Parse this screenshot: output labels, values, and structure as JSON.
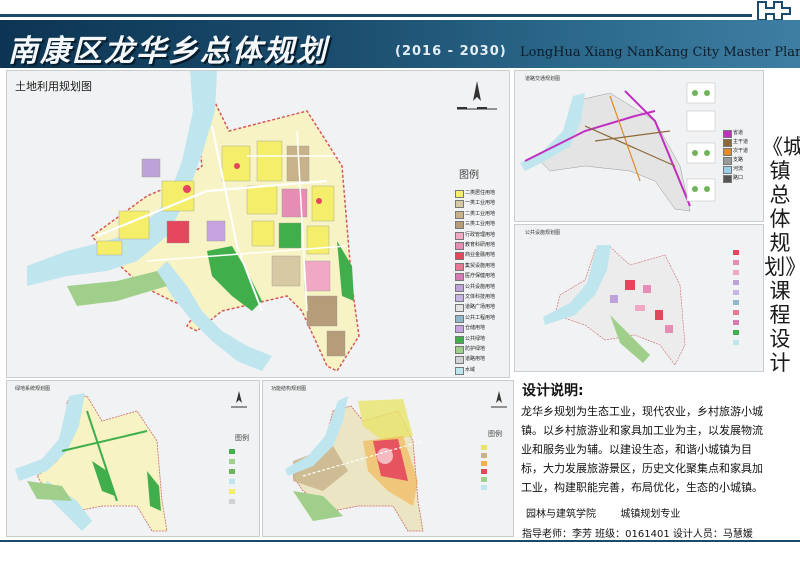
{
  "header": {
    "title_cn": "南康区龙华乡总体规划",
    "years": "(2016 - 2030)",
    "title_en": "LongHua Xiang NanKang City Master Plan"
  },
  "main_map": {
    "title": "土地利用规划图",
    "legend_title": "图例",
    "legend": [
      {
        "label": "二类居住用地",
        "color": "#f4ee6a"
      },
      {
        "label": "一类工业用地",
        "color": "#d7c9a3"
      },
      {
        "label": "二类工业用地",
        "color": "#c7b28a"
      },
      {
        "label": "三类工业用地",
        "color": "#b79c7a"
      },
      {
        "label": "行政管理用地",
        "color": "#f1a8c5"
      },
      {
        "label": "教育科研用地",
        "color": "#e58db5"
      },
      {
        "label": "商业金融用地",
        "color": "#e4475d"
      },
      {
        "label": "集贸设施用地",
        "color": "#e57a94"
      },
      {
        "label": "医疗保健用地",
        "color": "#d97ab7"
      },
      {
        "label": "公共设施用地",
        "color": "#bda2d7"
      },
      {
        "label": "文体科技用地",
        "color": "#c6b4e2"
      },
      {
        "label": "道路广场用地",
        "color": "#e3e3e3"
      },
      {
        "label": "公共工程用地",
        "color": "#8fb8c8"
      },
      {
        "label": "仓储用地",
        "color": "#c5a2e0"
      },
      {
        "label": "公共绿地",
        "color": "#3fae4b"
      },
      {
        "label": "防护绿地",
        "color": "#9fcf8a"
      },
      {
        "label": "道路用地",
        "color": "#cfd3d6"
      },
      {
        "label": "水域",
        "color": "#bfe5ee"
      }
    ]
  },
  "tr_map": {
    "title": "道路交通规划图",
    "legend": [
      {
        "label": "省道",
        "color": "#c02fc0"
      },
      {
        "label": "主干道",
        "color": "#8b6a3a"
      },
      {
        "label": "次干道",
        "color": "#e08a2a"
      },
      {
        "label": "支路",
        "color": "#9a9a9a"
      },
      {
        "label": "河流",
        "color": "#9ad0e8"
      },
      {
        "label": "路口",
        "color": "#555555"
      }
    ]
  },
  "mr_map": {
    "title": "公共设施规划图"
  },
  "bl_map": {
    "title": "绿地系统规划图",
    "legend_title": "图例"
  },
  "bm_map": {
    "title": "功能结构规划图",
    "legend_title": "图例"
  },
  "side_title": "《城镇总体规划》课程设计",
  "description": {
    "title": "设计说明:",
    "body": "龙华乡规划为生态工业，现代农业，乡村旅游小城镇。以乡村旅游业和家具加工业为主，以发展物流业和服务业为辅。以建设生态，和谐小城镇为目标，大力发展旅游景区，历史文化聚集点和家具加工业，构建职能完善，布局优化，生态的小城镇。",
    "school": "园林与建筑学院",
    "major": "城镇规划专业"
  },
  "footer": {
    "text": "指导老师：李芳    班级：0161401    设计人员：马慧媛"
  },
  "colors": {
    "header_dark": "#0d3553",
    "header_light": "#3f7ea3",
    "river": "#bfe5ee",
    "green": "#3fae4b",
    "residential": "#f4ee6a",
    "commercial": "#e4475d"
  }
}
